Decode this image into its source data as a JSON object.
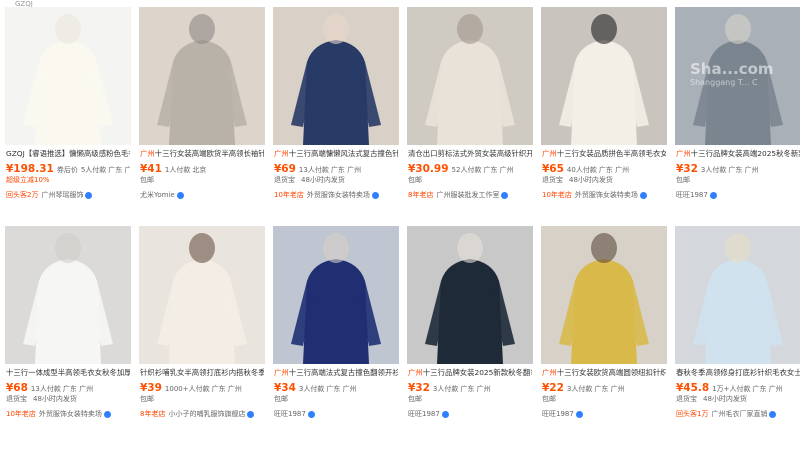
{
  "corner_text": "GZQJ",
  "watermark": {
    "main": "Sha...com",
    "sub": "Shanggang T... C"
  },
  "products": [
    {
      "title_tag": "",
      "title": "GZQJ【睿语推选】慵懒高级感粉色毛衣女",
      "price": "¥198.31",
      "price_suffix": "券后价",
      "sold": "5人付款",
      "location": "广东 广州",
      "ship": [],
      "ship2": "超级立减10%",
      "badge": "回头客2万",
      "shop": "广州琴瑶服饰"
    },
    {
      "title_tag": "广州",
      "title": "十三行女装高端欧货半高领长袖针",
      "price": "¥41",
      "price_suffix": "",
      "sold": "1人付款",
      "location": "北京",
      "ship": [
        "包邮"
      ],
      "ship2": "",
      "badge": "",
      "shop": "尤米Yomie"
    },
    {
      "title_tag": "广州",
      "title": "十三行高端慵懒风法式复古撞色针织",
      "price": "¥69",
      "price_suffix": "",
      "sold": "13人付款",
      "location": "广东 广州",
      "ship": [
        "退货宝",
        "48小时内发货"
      ],
      "ship2": "",
      "badge": "10年老店",
      "shop": "外贸服饰女装特卖场"
    },
    {
      "title_tag": "",
      "title": "清仓出口剪标法式外贸女装高级针织开衫",
      "price": "¥30.99",
      "price_suffix": "",
      "sold": "52人付款",
      "location": "广东 广州",
      "ship": [
        "包邮"
      ],
      "ship2": "",
      "badge": "8年老店",
      "shop": "广州服装批发工作室"
    },
    {
      "title_tag": "广州",
      "title": "十三行女装品质拼色半高领毛衣女",
      "price": "¥65",
      "price_suffix": "",
      "sold": "40人付款",
      "location": "广东 广州",
      "ship": [
        "退货宝",
        "48小时内发货"
      ],
      "ship2": "",
      "badge": "10年老店",
      "shop": "外贸服饰女装特卖场"
    },
    {
      "title_tag": "广州",
      "title": "十三行品牌女装高端2025秋冬新款",
      "price": "¥32",
      "price_suffix": "",
      "sold": "3人付款",
      "location": "广东 广州",
      "ship": [
        "包邮"
      ],
      "ship2": "",
      "badge": "",
      "shop": "旺旺1987"
    },
    {
      "title_tag": "",
      "title": "十三行一体成型半高领毛衣女秋冬加厚",
      "price": "¥68",
      "price_suffix": "",
      "sold": "13人付款",
      "location": "广东 广州",
      "ship": [
        "退货宝",
        "48小时内发货"
      ],
      "ship2": "",
      "badge": "10年老店",
      "shop": "外贸服饰女装特卖场"
    },
    {
      "title_tag": "",
      "title": "针织衫哺乳女半高领打底衫内搭秋冬季",
      "price": "¥39",
      "price_suffix": "",
      "sold": "1000+人付款",
      "location": "广东 广州",
      "ship": [
        "包邮"
      ],
      "ship2": "",
      "badge": "8年老店",
      "shop": "小小子的哺乳服饰旗舰店"
    },
    {
      "title_tag": "广州",
      "title": "十三行高端法式复古撞色翻领开衫",
      "price": "¥34",
      "price_suffix": "",
      "sold": "3人付款",
      "location": "广东 广州",
      "ship": [
        "包邮"
      ],
      "ship2": "",
      "badge": "",
      "shop": "旺旺1987"
    },
    {
      "title_tag": "广州",
      "title": "十三行品牌女装2025新款秋冬翻领",
      "price": "¥32",
      "price_suffix": "",
      "sold": "3人付款",
      "location": "广东 广州",
      "ship": [
        "包邮"
      ],
      "ship2": "",
      "badge": "",
      "shop": "旺旺1987"
    },
    {
      "title_tag": "广州",
      "title": "十三行女装欧货高端圆领纽扣针织衫",
      "price": "¥22",
      "price_suffix": "",
      "sold": "3人付款",
      "location": "广东 广州",
      "ship": [
        "包邮"
      ],
      "ship2": "",
      "badge": "",
      "shop": "旺旺1987"
    },
    {
      "title_tag": "",
      "title": "春秋冬季高领修身打底衫针织毛衣女士",
      "price": "¥45.8",
      "price_suffix": "",
      "sold": "1万+人付款",
      "location": "广东 广州",
      "ship": [
        "退货宝",
        "48小时内发货"
      ],
      "ship2": "",
      "badge": "回头客1万",
      "shop": "广州毛衣厂家直销"
    }
  ]
}
